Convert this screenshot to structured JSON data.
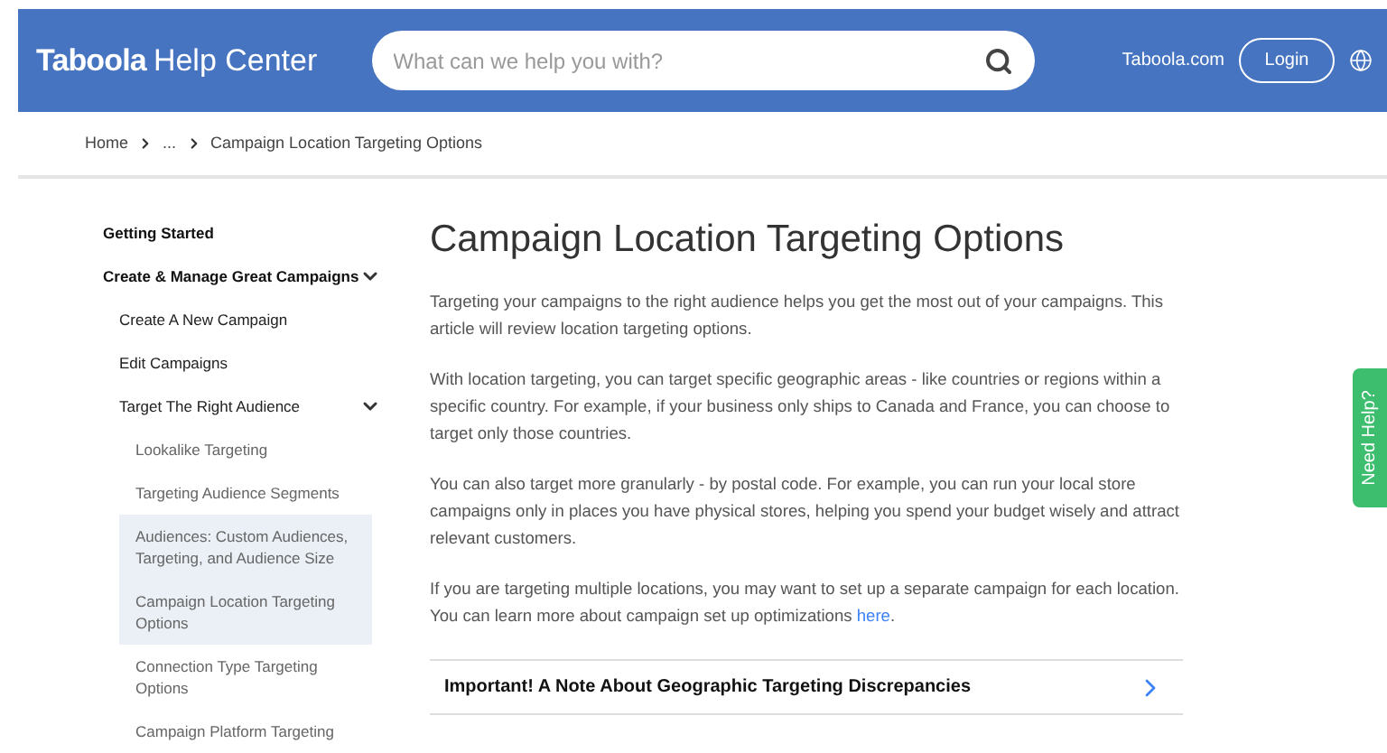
{
  "header": {
    "logo": "Taboola",
    "title": "Help Center",
    "search": {
      "placeholder": "What can we help you with?"
    },
    "site_link": "Taboola.com",
    "login": "Login"
  },
  "breadcrumb": [
    "Home",
    "...",
    "Campaign Location Targeting Options"
  ],
  "sidebar": {
    "items": [
      {
        "label": "Getting Started",
        "selected": false
      },
      {
        "label": "Create & Manage Great Campaigns",
        "selected": false,
        "expanded": true,
        "children": [
          {
            "label": "Create A New Campaign",
            "selected": false
          },
          {
            "label": "Edit Campaigns",
            "selected": false
          },
          {
            "label": "Target The Right Audience",
            "selected": false,
            "expanded": true,
            "children": [
              {
                "label": "Lookalike Targeting",
                "selected": false
              },
              {
                "label": "Targeting Audience Segments",
                "selected": false
              },
              {
                "label": "Audiences: Custom Audiences, Targeting, and Audience Size",
                "selected": true
              },
              {
                "label": "Campaign Location Targeting Options",
                "selected": true
              },
              {
                "label": "Connection Type Targeting Options",
                "selected": false
              },
              {
                "label": "Campaign Platform Targeting",
                "selected": false
              }
            ]
          }
        ]
      }
    ]
  },
  "article": {
    "title": "Campaign Location Targeting Options",
    "paragraphs": [
      {
        "text": "Targeting your campaigns to the right audience helps you get the most out of your campaigns. This article will review location targeting options."
      },
      {
        "text": "With location targeting, you can target specific geographic areas - like countries or regions within a specific country. For example, if your business only ships to Canada and France, you can choose to target only those countries."
      },
      {
        "text": "You can also target more granularly - by postal code. For example, you can run your local store campaigns only in places you have physical stores, helping you spend your budget wisely and attract relevant customers."
      },
      {
        "text": "If you are targeting multiple locations, you may want to set up a separate campaign for each location. You can learn more about campaign set up optimizations",
        "link": "here",
        "after": "."
      }
    ],
    "accordion": [
      {
        "label": "Important! A Note About Geographic Targeting Discrepancies",
        "expanded": false
      }
    ]
  },
  "help_tab": "Need Help?"
}
